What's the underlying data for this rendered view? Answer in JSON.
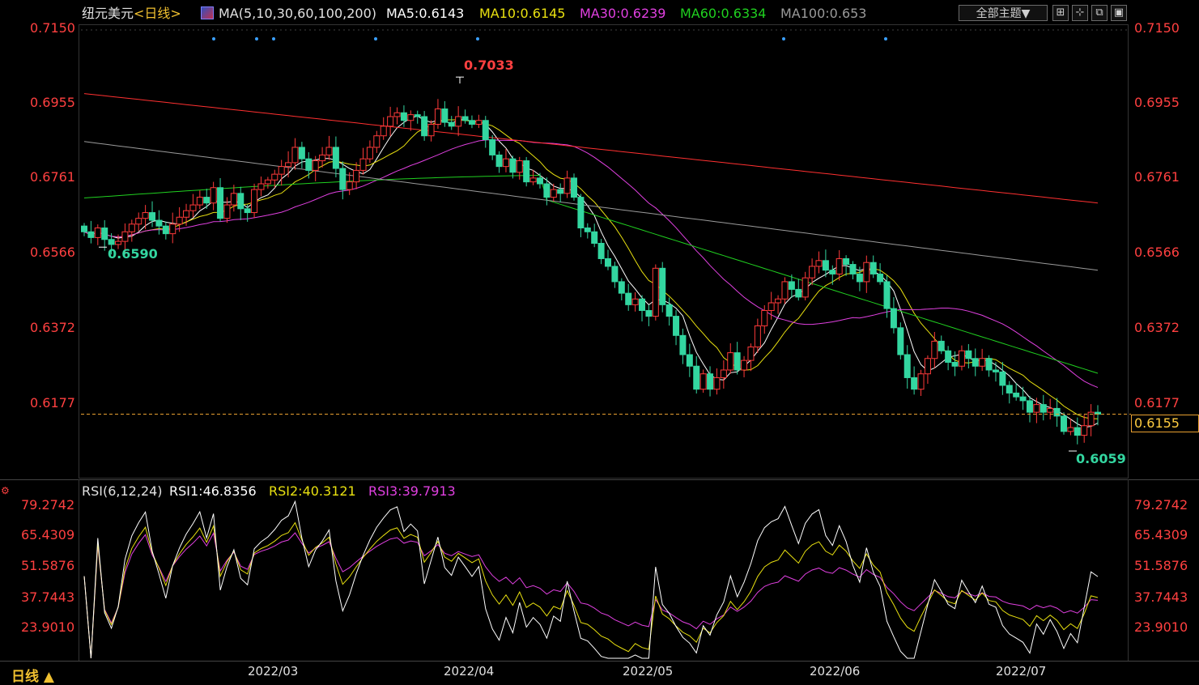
{
  "header": {
    "symbol": "纽元美元",
    "period_tag": "<日线>",
    "ma_label": "MA(5,10,30,60,100,200)",
    "ma_values": [
      {
        "text": "MA5:0.6143",
        "color": "#ffffff"
      },
      {
        "text": "MA10:0.6145",
        "color": "#e8e010"
      },
      {
        "text": "MA30:0.6239",
        "color": "#e040e0"
      },
      {
        "text": "MA60:0.6334",
        "color": "#20d020"
      },
      {
        "text": "MA100:0.653",
        "color": "#9a9a9a"
      }
    ]
  },
  "toolbar": {
    "theme_label": "全部主题▼",
    "icons": [
      "grid-icon",
      "crosshair-icon",
      "expand-icon",
      "panel-icon"
    ]
  },
  "colors": {
    "up": "#ff3a3a",
    "down": "#33d6a0",
    "axis_text": "#ff4040",
    "ma5": "#ffffff",
    "ma10": "#e8e010",
    "ma30": "#e040e0",
    "ma60": "#20d020",
    "ma100": "#9a9a9a",
    "ma200": "#ff3030",
    "last_line": "#e8a030"
  },
  "price_axis": {
    "ticks": [
      "0.7150",
      "0.6955",
      "0.6761",
      "0.6566",
      "0.6372",
      "0.6177"
    ]
  },
  "last_price_box": "0.6155",
  "annotations": {
    "high": "0.7033",
    "low1": "0.6590",
    "low2": "0.6059"
  },
  "rsi": {
    "label": "RSI(6,12,24)",
    "rsi1": "RSI1:46.8356",
    "rsi2": "RSI2:40.3121",
    "rsi3": "RSI3:39.7913",
    "ticks": [
      "79.2742",
      "65.4309",
      "51.5876",
      "37.7443",
      "23.9010"
    ]
  },
  "x_axis": {
    "months": [
      "2022/03",
      "2022/04",
      "2022/05",
      "2022/06",
      "2022/07"
    ]
  },
  "footer": {
    "period": "日线 ▲"
  },
  "chart_data": {
    "type": "candlestick",
    "title": "纽元美元",
    "ylim": [
      0.6,
      0.7162
    ],
    "close": [
      0.663,
      0.6615,
      0.664,
      0.661,
      0.6597,
      0.6605,
      0.663,
      0.665,
      0.6665,
      0.668,
      0.666,
      0.6645,
      0.6625,
      0.665,
      0.6668,
      0.6685,
      0.67,
      0.672,
      0.6705,
      0.6745,
      0.6665,
      0.67,
      0.673,
      0.669,
      0.668,
      0.674,
      0.6755,
      0.6765,
      0.678,
      0.68,
      0.681,
      0.685,
      0.682,
      0.679,
      0.6815,
      0.683,
      0.685,
      0.6795,
      0.674,
      0.676,
      0.679,
      0.682,
      0.685,
      0.688,
      0.6905,
      0.693,
      0.694,
      0.692,
      0.6935,
      0.693,
      0.688,
      0.691,
      0.695,
      0.6915,
      0.6905,
      0.693,
      0.692,
      0.691,
      0.692,
      0.687,
      0.683,
      0.68,
      0.682,
      0.6785,
      0.6815,
      0.676,
      0.677,
      0.6755,
      0.672,
      0.674,
      0.673,
      0.677,
      0.672,
      0.664,
      0.663,
      0.66,
      0.656,
      0.654,
      0.65,
      0.647,
      0.644,
      0.6455,
      0.6425,
      0.641,
      0.6535,
      0.644,
      0.641,
      0.636,
      0.631,
      0.628,
      0.622,
      0.626,
      0.622,
      0.625,
      0.627,
      0.6315,
      0.627,
      0.6295,
      0.633,
      0.6385,
      0.6425,
      0.6445,
      0.6455,
      0.65,
      0.648,
      0.646,
      0.651,
      0.654,
      0.6555,
      0.653,
      0.652,
      0.656,
      0.6545,
      0.652,
      0.65,
      0.655,
      0.652,
      0.65,
      0.643,
      0.638,
      0.631,
      0.625,
      0.622,
      0.626,
      0.63,
      0.6345,
      0.632,
      0.629,
      0.628,
      0.632,
      0.63,
      0.628,
      0.63,
      0.627,
      0.6265,
      0.623,
      0.621,
      0.62,
      0.619,
      0.616,
      0.618,
      0.616,
      0.617,
      0.615,
      0.611,
      0.612,
      0.61,
      0.6125,
      0.616,
      0.6155
    ],
    "ma": {
      "MA5": 0.6143,
      "MA10": 0.6145,
      "MA30": 0.6239,
      "MA60": 0.6334,
      "MA100": 0.653
    },
    "high_marker": 0.7033,
    "low_markers": [
      0.659,
      0.6059
    ],
    "last_price": 0.6155,
    "x_ticks": [
      "2022/03",
      "2022/04",
      "2022/05",
      "2022/06",
      "2022/07"
    ],
    "rsi": {
      "rsi1": 46.8356,
      "rsi2": 40.3121,
      "rsi3": 39.7913,
      "ylim": [
        14,
        86
      ]
    }
  }
}
